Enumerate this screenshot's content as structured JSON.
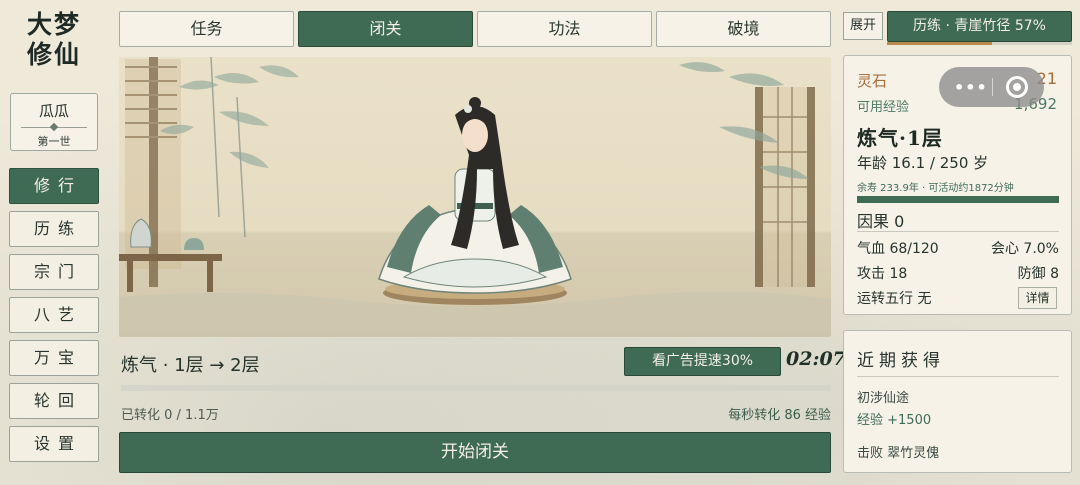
{
  "app": {
    "logo": [
      "大梦",
      "修仙"
    ]
  },
  "profile": {
    "name": "瓜瓜",
    "generation": "第一世"
  },
  "nav": [
    {
      "label": "修行",
      "active": true
    },
    {
      "label": "历练",
      "active": false
    },
    {
      "label": "宗门",
      "active": false
    },
    {
      "label": "八艺",
      "active": false
    },
    {
      "label": "万宝",
      "active": false
    },
    {
      "label": "轮回",
      "active": false
    },
    {
      "label": "设置",
      "active": false
    }
  ],
  "tabs": [
    {
      "label": "任务",
      "active": false
    },
    {
      "label": "闭关",
      "active": true
    },
    {
      "label": "功法",
      "active": false
    },
    {
      "label": "破境",
      "active": false
    }
  ],
  "cultivation": {
    "stage_title": "炼气 · 1层 → 2层",
    "ad_button": "看广告提速30%",
    "timer": "02:07",
    "progress": 0,
    "converted": "已转化 0 / 1.1万",
    "rate": "每秒转化 86 经验",
    "start_button": "开始闭关"
  },
  "right": {
    "expand_button": "展开",
    "training_button": "历练 · 青崖竹径 57%",
    "training_progress": 0.57,
    "stats": {
      "lingshi_label": "灵石",
      "lingshi_value": "21",
      "exp_label": "可用经验",
      "exp_value": "1,692",
      "realm": "炼气·1层",
      "age": "年龄 16.1 / 250 岁",
      "lifespan": "余寿 233.9年 · 可活动约1872分钟",
      "karma": "因果  0",
      "hp": "气血 68/120",
      "crit": "会心  7.0%",
      "attack": "攻击  18",
      "defense": "防御   8",
      "five_elements": "运转五行  无",
      "detail_button": "详情"
    },
    "recent": {
      "title": "近期获得",
      "items": [
        "初涉仙途",
        "经验 +1500",
        "击败 翠竹灵傀"
      ]
    }
  },
  "colors": {
    "primary_green": "#3f6b55",
    "paper": "#efe9da",
    "gold": "#a86e3a",
    "training_bar": "#b98a4b"
  },
  "icons": [
    "more-dots-icon",
    "close-circle-icon"
  ]
}
